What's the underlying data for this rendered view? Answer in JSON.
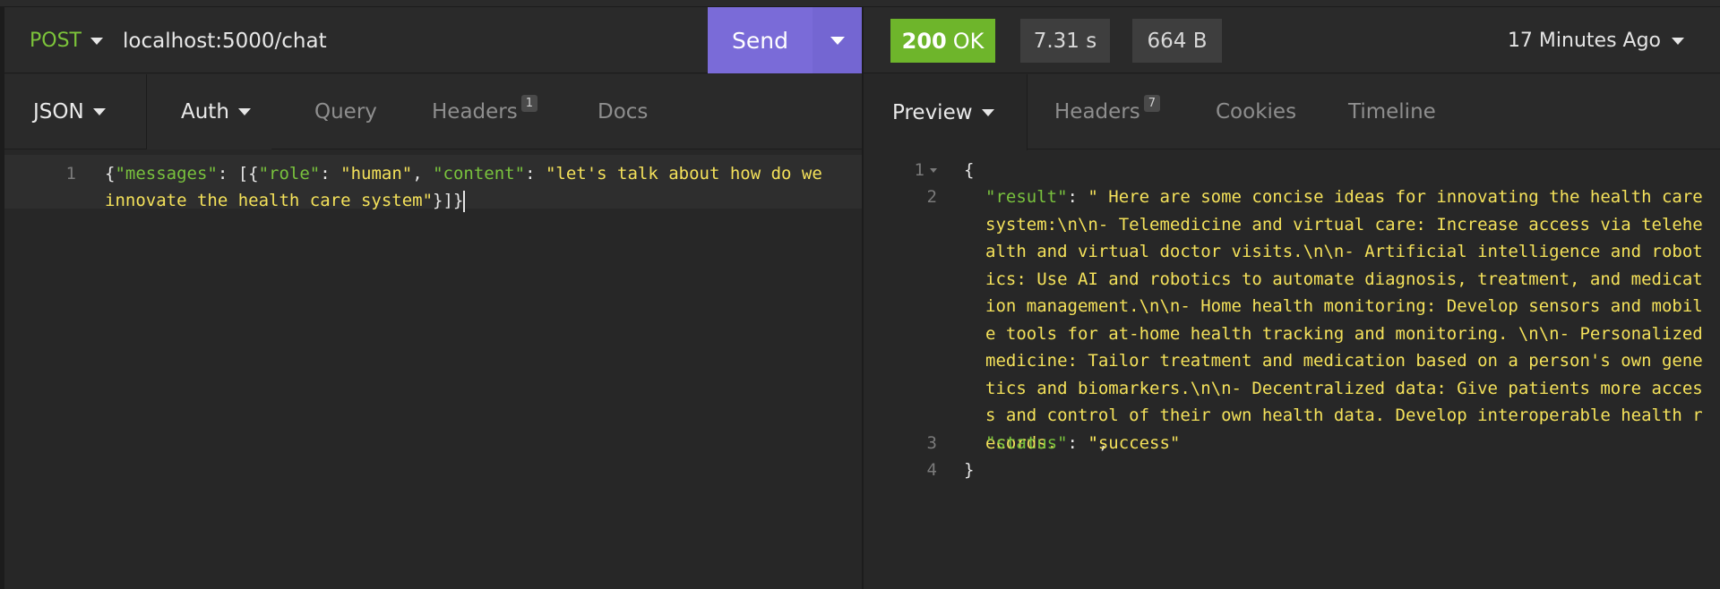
{
  "request": {
    "method": "POST",
    "url": "localhost:5000/chat",
    "send_label": "Send",
    "tabs": {
      "body": "JSON",
      "auth": "Auth",
      "query": "Query",
      "headers": "Headers",
      "headers_count": "1",
      "docs": "Docs"
    },
    "body": {
      "line_number": "1",
      "key_messages": "\"messages\"",
      "key_role": "\"role\"",
      "val_role": "\"human\"",
      "key_content": "\"content\"",
      "val_content_1": "\"let's talk about how do we",
      "val_content_2": "innovate the health care system\"",
      "closing": "}]}"
    }
  },
  "response": {
    "status_code": "200",
    "status_text": "OK",
    "time": "7.31 s",
    "size": "664 B",
    "when": "17 Minutes Ago",
    "tabs": {
      "preview": "Preview",
      "headers": "Headers",
      "headers_count": "7",
      "cookies": "Cookies",
      "timeline": "Timeline"
    },
    "body": {
      "lines": [
        "1",
        "2",
        "3",
        "4"
      ],
      "open_brace": "{",
      "key_result": "\"result\"",
      "val_result": "\" Here are some concise ideas for innovating the health care system:\\n\\n- Telemedicine and virtual care: Increase access via telehealth and virtual doctor visits.\\n\\n- Artificial intelligence and robotics: Use AI and robotics to automate diagnosis, treatment, and medication management.\\n\\n- Home health monitoring: Develop sensors and mobile tools for at-home health tracking and monitoring. \\n\\n- Personalized medicine: Tailor treatment and medication based on a person's own genetics and biomarkers.\\n\\n- Decentralized data: Give patients more access and control of their own health data. Develop interoperable health records.   \"",
      "key_status": "\"status\"",
      "val_status": "\"success\"",
      "close_brace": "}"
    }
  },
  "colors": {
    "accent_send": "#7a6bd8",
    "status_ok": "#6eb52b",
    "method_post": "#7cc43a",
    "json_key": "#79c23d",
    "json_string": "#f4e15a"
  }
}
